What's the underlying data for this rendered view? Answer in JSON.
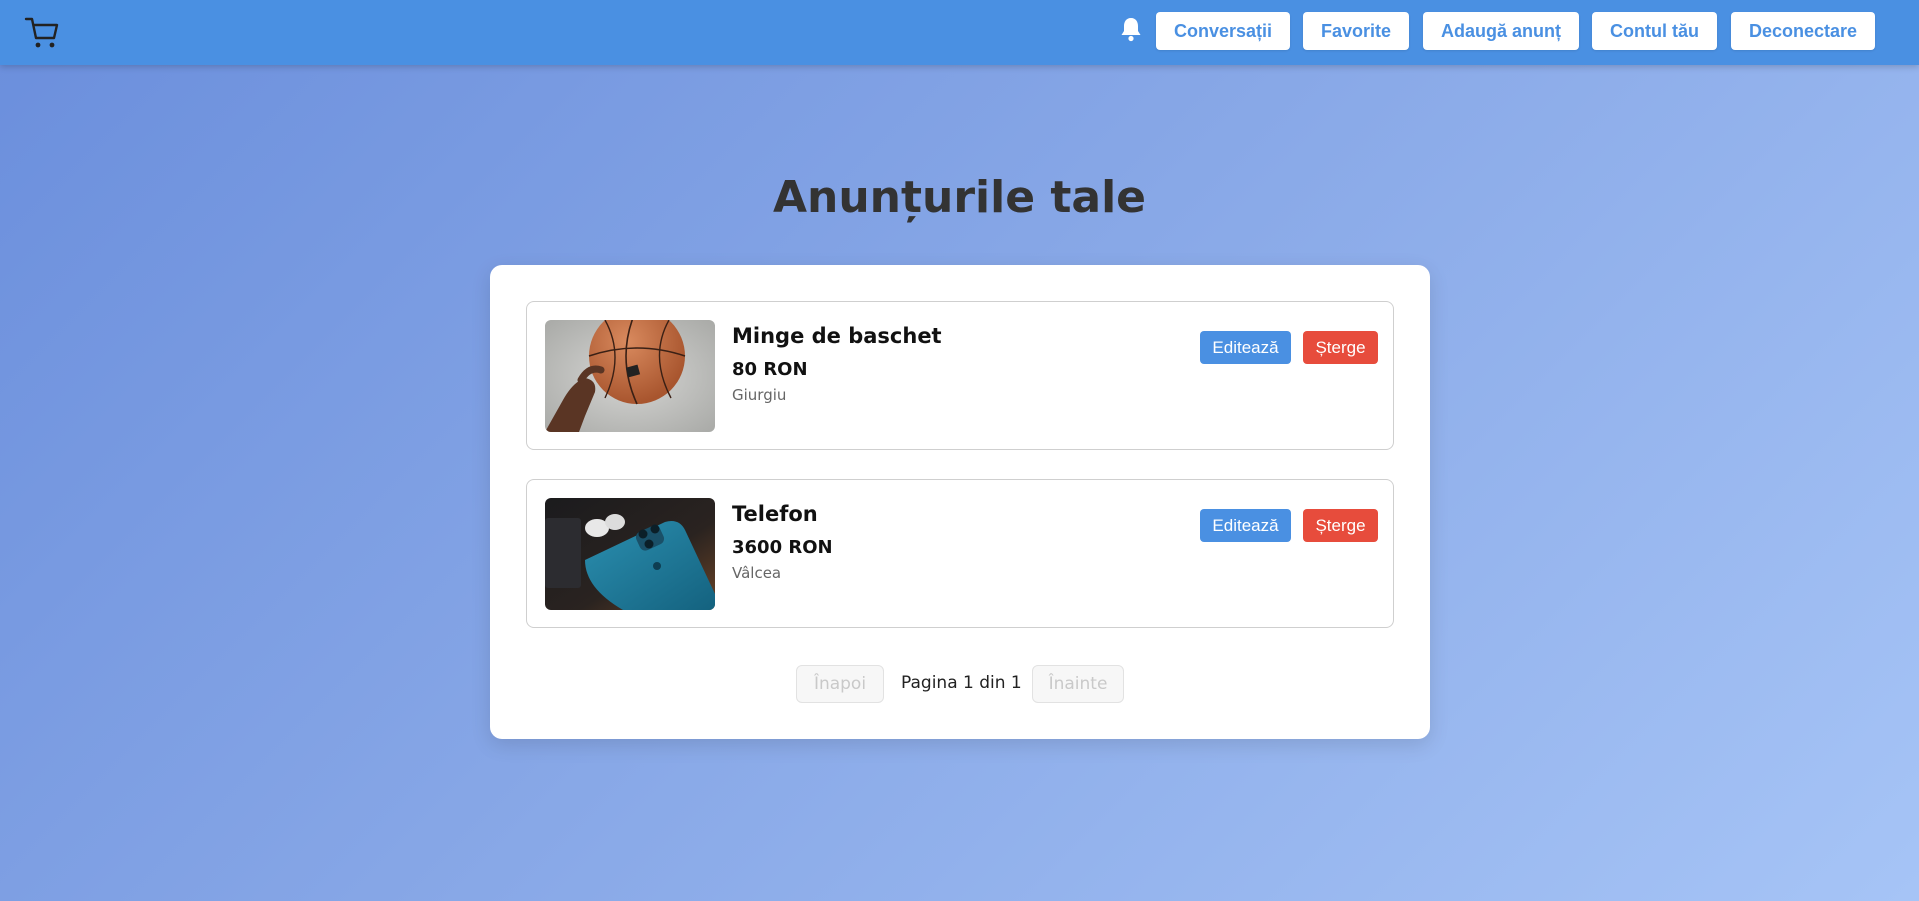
{
  "navbar": {
    "logo_icon": "shopping-cart-icon",
    "notification_icon": "bell-icon",
    "buttons": {
      "conversations": "Conversații",
      "favorites": "Favorite",
      "add_listing": "Adaugă anunț",
      "account": "Contul tău",
      "logout": "Deconectare"
    },
    "color": "#4a90e2"
  },
  "page": {
    "title": "Anunțurile tale"
  },
  "listings": [
    {
      "title": "Minge de baschet",
      "price": "80 RON",
      "location": "Giurgiu",
      "image": "basketball-photo",
      "edit_label": "Editează",
      "delete_label": "Șterge"
    },
    {
      "title": "Telefon",
      "price": "3600 RON",
      "location": "Vâlcea",
      "image": "phone-photo",
      "edit_label": "Editează",
      "delete_label": "Șterge"
    }
  ],
  "pagination": {
    "prev_label": "Înapoi",
    "next_label": "Înainte",
    "status": "Pagina 1 din 1",
    "current_page": 1,
    "total_pages": 1
  },
  "colors": {
    "edit": "#4a90e2",
    "delete": "#e74c3c"
  }
}
